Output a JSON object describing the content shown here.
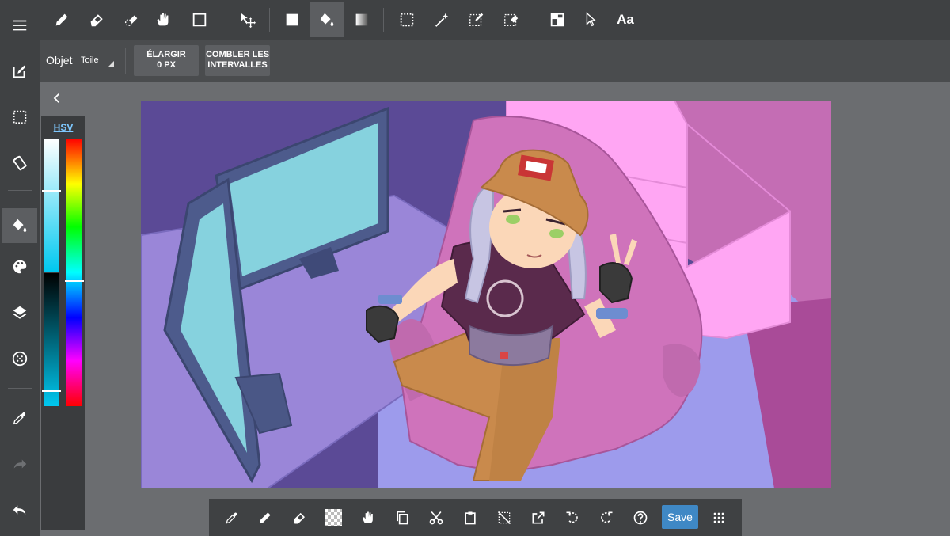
{
  "top_toolbar": {
    "tools": [
      "pencil-icon",
      "eraser-icon",
      "soft-eraser-icon",
      "hand-icon",
      "rectangle-icon",
      "move-selection-icon",
      "fill-color-icon",
      "bucket-icon",
      "gradient-icon",
      "rect-select-icon",
      "magic-wand-icon",
      "select-pen-icon",
      "select-eraser-icon",
      "layout-icon",
      "pointer-icon",
      "text-icon"
    ],
    "text_tool_label": "Aa",
    "active_tool": "bucket-icon"
  },
  "options_bar": {
    "object_label": "Objet",
    "source_select": "Toile",
    "expand_label": "ÉLARGIR",
    "expand_value": "0 PX",
    "fill_gaps_label": "COMBLER LES INTERVALLES"
  },
  "left_toolbar": {
    "items": [
      "menu-icon",
      "edit-icon",
      "selection-icon",
      "transform-icon",
      "bucket-icon",
      "palette-icon",
      "layers-icon",
      "dots-circle-icon",
      "eyedropper-icon",
      "redo-icon",
      "undo-icon"
    ],
    "active": "bucket-icon"
  },
  "color_panel": {
    "mode_tab": "HSV",
    "current_color": "#00c8f0"
  },
  "bottom_toolbar": {
    "tools": [
      "eyedropper-icon",
      "pencil-icon",
      "eraser-icon",
      "transparent-color-icon",
      "hand-icon",
      "copy-icon",
      "cut-icon",
      "paste-icon",
      "deselect-icon",
      "export-icon",
      "rotate-left-icon",
      "rotate-right-icon",
      "help-icon"
    ],
    "save_label": "Save",
    "more_icon": "grid-dots-icon"
  },
  "colors": {
    "accent": "#3f88c5",
    "toolbar": "#3f4143",
    "workspace": "#6b6d70"
  }
}
